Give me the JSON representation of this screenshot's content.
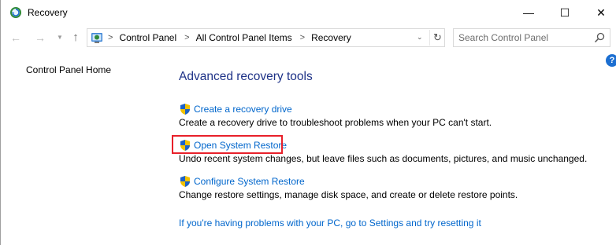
{
  "window": {
    "title": "Recovery",
    "minimize_glyph": "—",
    "maximize_glyph": "☐",
    "close_glyph": "✕"
  },
  "address_bar": {
    "breadcrumbs": [
      "Control Panel",
      "All Control Panel Items",
      "Recovery"
    ],
    "separator": ">"
  },
  "search": {
    "placeholder": "Search Control Panel"
  },
  "sidebar": {
    "home_link": "Control Panel Home"
  },
  "main": {
    "heading": "Advanced recovery tools",
    "tools": [
      {
        "label": "Create a recovery drive",
        "description": "Create a recovery drive to troubleshoot problems when your PC can't start."
      },
      {
        "label": "Open System Restore",
        "description": "Undo recent system changes, but leave files such as documents, pictures, and music unchanged."
      },
      {
        "label": "Configure System Restore",
        "description": "Change restore settings, manage disk space, and create or delete restore points."
      }
    ],
    "reset_link": "If you're having problems with your PC, go to Settings and try resetting it"
  },
  "help": {
    "label": "?"
  },
  "colors": {
    "link": "#0066cc",
    "heading": "#1e3287",
    "highlight_box": "#e8202a"
  },
  "icons": {
    "title_icon": "recovery-icon",
    "shield_icon": "uac-shield-icon",
    "search_icon": "search-icon"
  }
}
